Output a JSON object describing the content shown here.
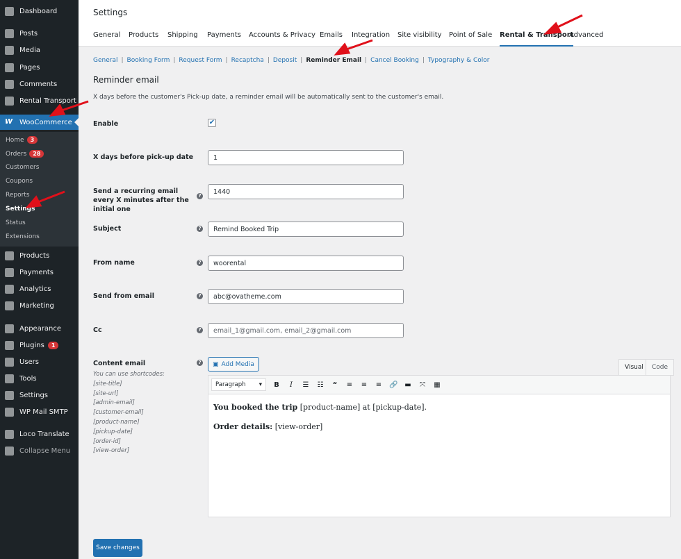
{
  "sidebar": {
    "items": [
      {
        "label": "Dashboard",
        "icon": "dashboard-icon"
      },
      {
        "label": "Posts",
        "icon": "pin-icon"
      },
      {
        "label": "Media",
        "icon": "media-icon"
      },
      {
        "label": "Pages",
        "icon": "pages-icon"
      },
      {
        "label": "Comments",
        "icon": "comment-icon"
      },
      {
        "label": "Rental Transport",
        "icon": "car-icon"
      },
      {
        "label": "WooCommerce",
        "icon": "woo-icon"
      },
      {
        "label": "Products",
        "icon": "archive-icon"
      },
      {
        "label": "Payments",
        "icon": "dollar-icon"
      },
      {
        "label": "Analytics",
        "icon": "chart-icon"
      },
      {
        "label": "Marketing",
        "icon": "megaphone-icon"
      },
      {
        "label": "Appearance",
        "icon": "brush-icon"
      },
      {
        "label": "Plugins",
        "icon": "plugin-icon",
        "badge": "1"
      },
      {
        "label": "Users",
        "icon": "user-icon"
      },
      {
        "label": "Tools",
        "icon": "wrench-icon"
      },
      {
        "label": "Settings",
        "icon": "settings-icon"
      },
      {
        "label": "WP Mail SMTP",
        "icon": "mail-icon"
      },
      {
        "label": "Loco Translate",
        "icon": "translate-icon"
      },
      {
        "label": "Collapse Menu",
        "icon": "collapse-icon"
      }
    ],
    "submenu": [
      {
        "label": "Home",
        "badge": "3"
      },
      {
        "label": "Orders",
        "badge": "28"
      },
      {
        "label": "Customers"
      },
      {
        "label": "Coupons"
      },
      {
        "label": "Reports"
      },
      {
        "label": "Settings"
      },
      {
        "label": "Status"
      },
      {
        "label": "Extensions"
      }
    ]
  },
  "header": {
    "title": "Settings",
    "tabs": [
      "General",
      "Products",
      "Shipping",
      "Payments",
      "Accounts & Privacy",
      "Emails",
      "Integration",
      "Site visibility",
      "Point of Sale",
      "Rental & Transport",
      "Advanced"
    ]
  },
  "subnav": [
    "General",
    "Booking Form",
    "Request Form",
    "Recaptcha",
    "Deposit",
    "Reminder Email",
    "Cancel Booking",
    "Typography & Color"
  ],
  "section": {
    "title": "Reminder email",
    "description": "X days before the customer's Pick-up date, a reminder email will be automatically sent to the customer's email."
  },
  "form": {
    "enable_label": "Enable",
    "enable_checked": true,
    "days_label": "X days before pick-up date",
    "days_value": "1",
    "recurring_label": "Send a recurring email every X minutes after the initial one",
    "recurring_value": "1440",
    "subject_label": "Subject",
    "subject_value": "Remind Booked Trip",
    "from_name_label": "From name",
    "from_name_value": "woorental",
    "from_email_label": "Send from email",
    "from_email_value": "abc@ovatheme.com",
    "cc_label": "Cc",
    "cc_placeholder": "email_1@gmail.com, email_2@gmail.com",
    "content_label": "Content email",
    "shortcodes": [
      "You can use shortcodes:",
      "[site-title]",
      "[site-url]",
      "[admin-email]",
      "[customer-email]",
      "[product-name]",
      "[pickup-date]",
      "[order-id]",
      "[view-order]"
    ],
    "help": "?"
  },
  "editor": {
    "add_media": "Add Media",
    "tab_visual": "Visual",
    "tab_code": "Code",
    "format": "Paragraph",
    "line1_bold": "You booked the trip",
    "line1_rest": " [product-name] at [pickup-date].",
    "line2_bold": "Order details:",
    "line2_rest": " [view-order]"
  },
  "save_label": "Save changes",
  "colors": {
    "accent": "#2271b1",
    "sidebar": "#1d2327",
    "badge": "#d63638",
    "arrow": "#e0101a"
  }
}
